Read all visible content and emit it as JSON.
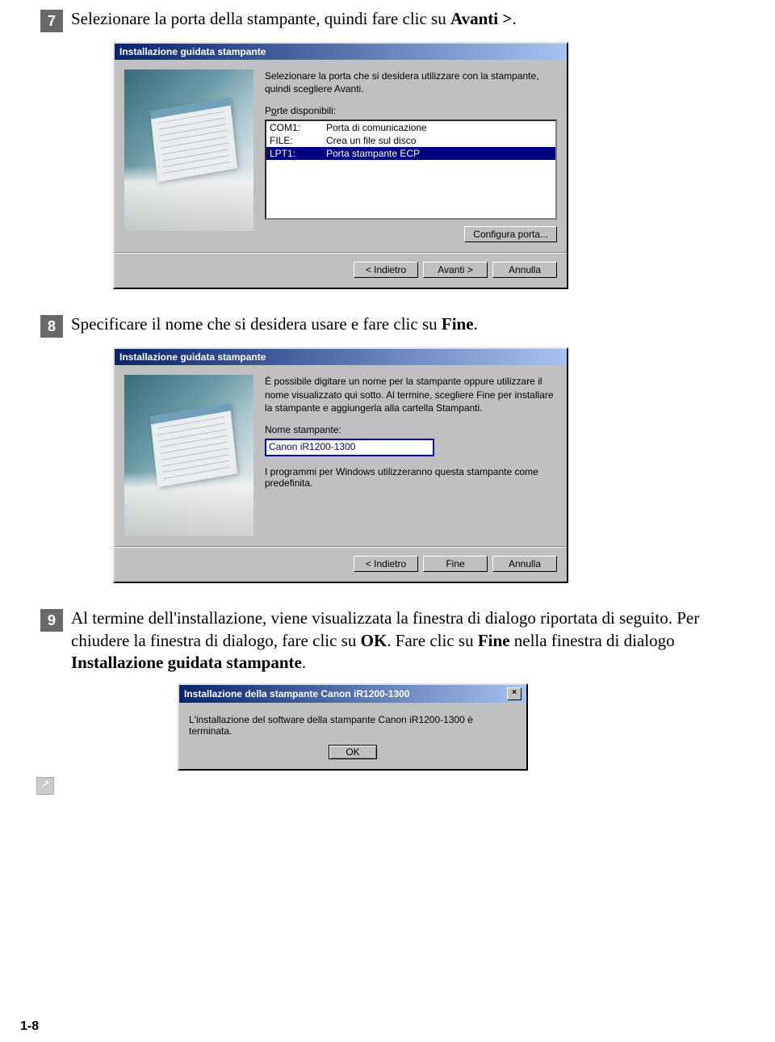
{
  "pageNumber": "1-8",
  "steps": {
    "s7": {
      "num": "7",
      "text_before": "Selezionare la porta della stampante, quindi fare clic su ",
      "bold1": "Avanti >",
      "text_after": "."
    },
    "s8": {
      "num": "8",
      "text_before": "Specificare il nome che si desidera usare e fare clic su ",
      "bold1": "Fine",
      "text_after": "."
    },
    "s9": {
      "num": "9",
      "t1": "Al termine dell'installazione, viene visualizzata la finestra di dialogo riportata di seguito. Per chiudere la finestra di dialogo, fare clic su ",
      "b1": "OK",
      "t2": ". Fare clic su ",
      "b2": "Fine",
      "t3": " nella finestra di dialogo ",
      "b3": "Installazione guidata stampante",
      "t4": "."
    }
  },
  "dialog1": {
    "title": "Installazione guidata stampante",
    "desc": "Selezionare la porta che si desidera utilizzare con la stampante, quindi scegliere Avanti.",
    "portsLabelPre": "P",
    "portsLabelU": "o",
    "portsLabelPost": "rte disponibili:",
    "rows": [
      {
        "c1": "COM1:",
        "c2": "Porta di comunicazione",
        "sel": false
      },
      {
        "c1": "FILE:",
        "c2": "Crea un file sul disco",
        "sel": false
      },
      {
        "c1": "LPT1:",
        "c2": "Porta stampante ECP",
        "sel": true
      }
    ],
    "configBtn": "Configura porta...",
    "backBtn": "< Indietro",
    "nextBtn": "Avanti >",
    "cancelBtn": "Annulla"
  },
  "dialog2": {
    "title": "Installazione guidata stampante",
    "desc": "È possibile digitare un nome per la stampante oppure utilizzare il nome visualizzato qui sotto. Al termine, scegliere Fine per installare la stampante e aggiungerla alla cartella Stampanti.",
    "nameLabel": "Nome stampante:",
    "nameValue": "Canon iR1200-1300",
    "note": "I programmi per Windows utilizzeranno questa stampante come predefinita.",
    "backBtn": "< Indietro",
    "finishBtn": "Fine",
    "cancelBtn": "Annulla"
  },
  "msgbox": {
    "title": "Installazione della stampante Canon iR1200-1300",
    "body": "L'installazione del software della stampante Canon iR1200-1300 è terminata.",
    "ok": "OK"
  }
}
